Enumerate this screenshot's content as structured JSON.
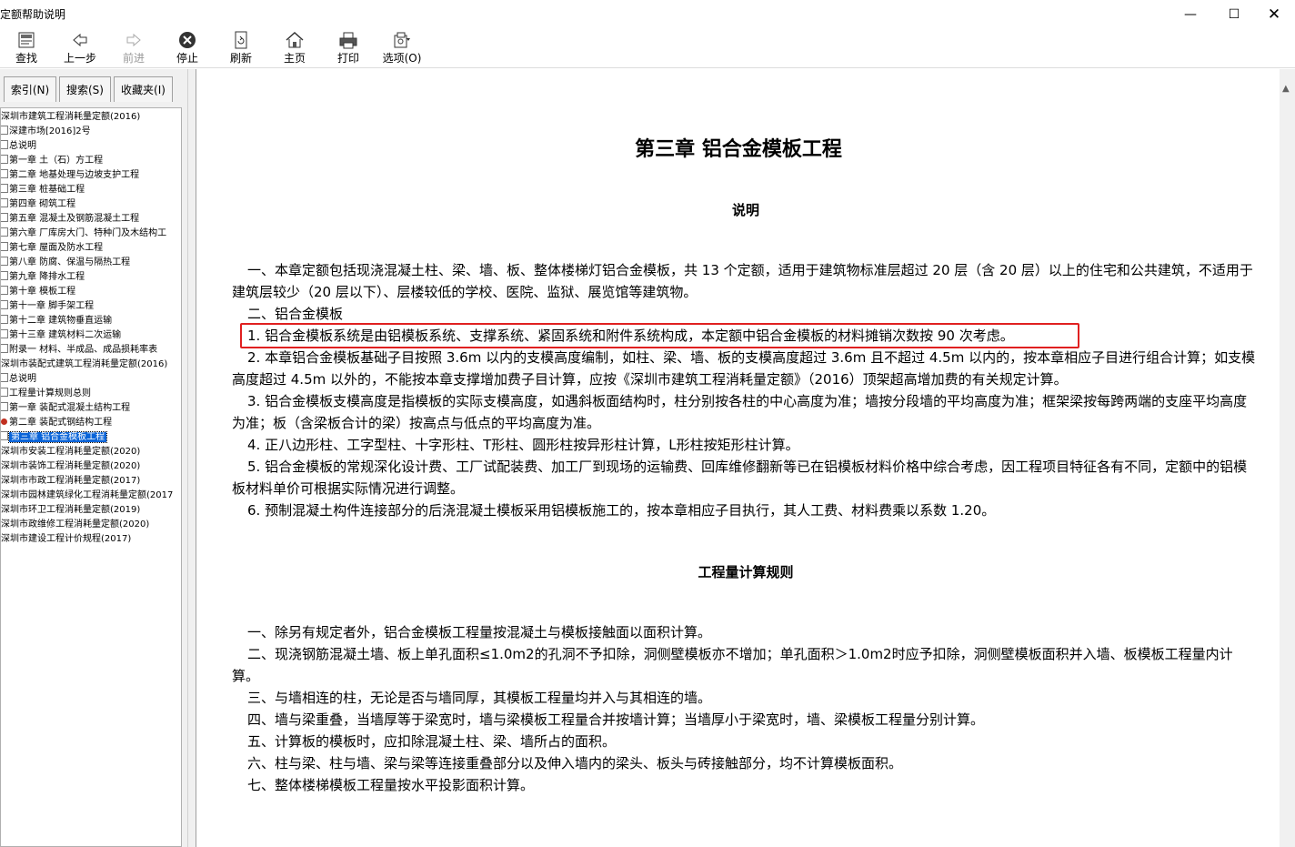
{
  "window": {
    "title": "定额帮助说明",
    "min": "—",
    "max": "☐",
    "close": "✕"
  },
  "toolbar": {
    "find": "查找",
    "back": "上一步",
    "forward": "前进",
    "stop": "停止",
    "refresh": "刷新",
    "home": "主页",
    "print": "打印",
    "options": "选项(O)"
  },
  "tabs": {
    "index": "索引(N)",
    "search": "搜索(S)",
    "favorites": "收藏夹(I)"
  },
  "tree": [
    "深圳市建筑工程消耗量定额(2016)",
    "深建市场[2016]2号",
    "总说明",
    "第一章  土（石）方工程",
    "第二章  地基处理与边坡支护工程",
    "第三章  桩基础工程",
    "第四章  砌筑工程",
    "第五章  混凝土及钢筋混凝土工程",
    "第六章  厂库房大门、特种门及木结构工",
    "第七章  屋面及防水工程",
    "第八章  防腐、保温与隔热工程",
    "第九章  降排水工程",
    "第十章  模板工程",
    "第十一章  脚手架工程",
    "第十二章  建筑物垂直运输",
    "第十三章  建筑材料二次运输",
    "附录一  材料、半成品、成品损耗率表",
    "深圳市装配式建筑工程消耗量定额(2016)",
    "总说明",
    "工程量计算规则总则",
    "第一章  装配式混凝土结构工程",
    "第二章  装配式钢结构工程",
    "第三章  铝合金模板工程",
    "深圳市安装工程消耗量定额(2020)",
    "深圳市装饰工程消耗量定额(2020)",
    "深圳市市政工程消耗量定额(2017)",
    "深圳市园林建筑绿化工程消耗量定额(2017",
    "深圳市环卫工程消耗量定额(2019)",
    "深圳市政维修工程消耗量定额(2020)",
    "深圳市建设工程计价规程(2017)"
  ],
  "doc": {
    "chapter_title": "第三章  铝合金模板工程",
    "section1_title": "说明",
    "p1": "一、本章定额包括现浇混凝土柱、梁、墙、板、整体楼梯灯铝合金模板，共 13 个定额，适用于建筑物标准层超过 20 层（含 20 层）以上的住宅和公共建筑，不适用于建筑层较少（20 层以下）、层楼较低的学校、医院、监狱、展览馆等建筑物。",
    "p2": "二、铝合金模板",
    "p3": "1. 铝合金模板系统是由铝模板系统、支撑系统、紧固系统和附件系统构成，本定额中铝合金模板的材料摊销次数按 90 次考虑。",
    "p4": "2. 本章铝合金模板基础子目按照 3.6m 以内的支模高度编制，如柱、梁、墙、板的支模高度超过 3.6m 且不超过 4.5m 以内的，按本章相应子目进行组合计算；如支模高度超过 4.5m 以外的，不能按本章支撑增加费子目计算，应按《深圳市建筑工程消耗量定额》（2016）顶架超高增加费的有关规定计算。",
    "p5": "3. 铝合金模板支模高度是指模板的实际支模高度，如遇斜板面结构时，柱分别按各柱的中心高度为准；墙按分段墙的平均高度为准；框架梁按每跨两端的支座平均高度为准；板（含梁板合计的梁）按高点与低点的平均高度为准。",
    "p6": "4. 正八边形柱、工字型柱、十字形柱、T形柱、圆形柱按异形柱计算，L形柱按矩形柱计算。",
    "p7": "5. 铝合金模板的常规深化设计费、工厂试配装费、加工厂到现场的运输费、回库维修翻新等已在铝模板材料价格中综合考虑，因工程项目特征各有不同，定额中的铝模板材料单价可根据实际情况进行调整。",
    "p8": "6. 预制混凝土构件连接部分的后浇混凝土模板采用铝模板施工的，按本章相应子目执行，其人工费、材料费乘以系数 1.20。",
    "section2_title": "工程量计算规则",
    "r1": "一、除另有规定者外，铝合金模板工程量按混凝土与模板接触面以面积计算。",
    "r2": "二、现浇钢筋混凝土墙、板上单孔面积≤1.0m2的孔洞不予扣除，洞侧壁模板亦不增加；单孔面积＞1.0m2时应予扣除，洞侧壁模板面积并入墙、板模板工程量内计算。",
    "r3": "三、与墙相连的柱，无论是否与墙同厚，其模板工程量均并入与其相连的墙。",
    "r4": "四、墙与梁重叠，当墙厚等于梁宽时，墙与梁模板工程量合并按墙计算；当墙厚小于梁宽时，墙、梁模板工程量分别计算。",
    "r5": "五、计算板的模板时，应扣除混凝土柱、梁、墙所占的面积。",
    "r6": "六、柱与梁、柱与墙、梁与梁等连接重叠部分以及伸入墙内的梁头、板头与砖接触部分，均不计算模板面积。",
    "r7": "七、整体楼梯模板工程量按水平投影面积计算。"
  },
  "colors": {
    "highlight_border": "#e02020",
    "selection": "#0a64d8"
  }
}
